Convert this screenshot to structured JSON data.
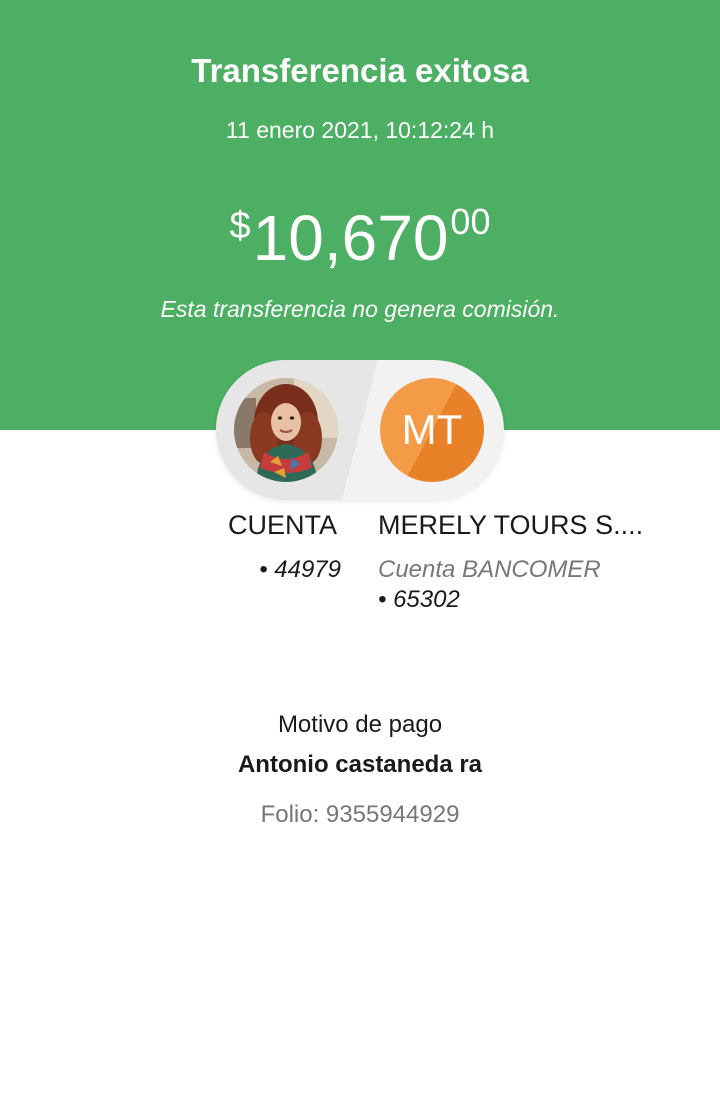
{
  "header": {
    "title": "Transferencia exitosa",
    "datetime": "11 enero 2021, 10:12:24 h",
    "amount": {
      "currency": "$",
      "whole": "10,670",
      "cents": "00"
    },
    "fee_note": "Esta transferencia no genera comisión.",
    "background_color": "#4caf63"
  },
  "from_account": {
    "label": "CUENTA",
    "number": "• 44979",
    "avatar": "profile-photo"
  },
  "to_account": {
    "name": "MERELY TOURS S....",
    "bank": "Cuenta BANCOMER",
    "number": "• 65302",
    "initials": "MT",
    "avatar_color": "#f39b47"
  },
  "payment": {
    "reason_label": "Motivo de pago",
    "reason_value": "Antonio castaneda ra",
    "folio": "Folio: 9355944929"
  }
}
